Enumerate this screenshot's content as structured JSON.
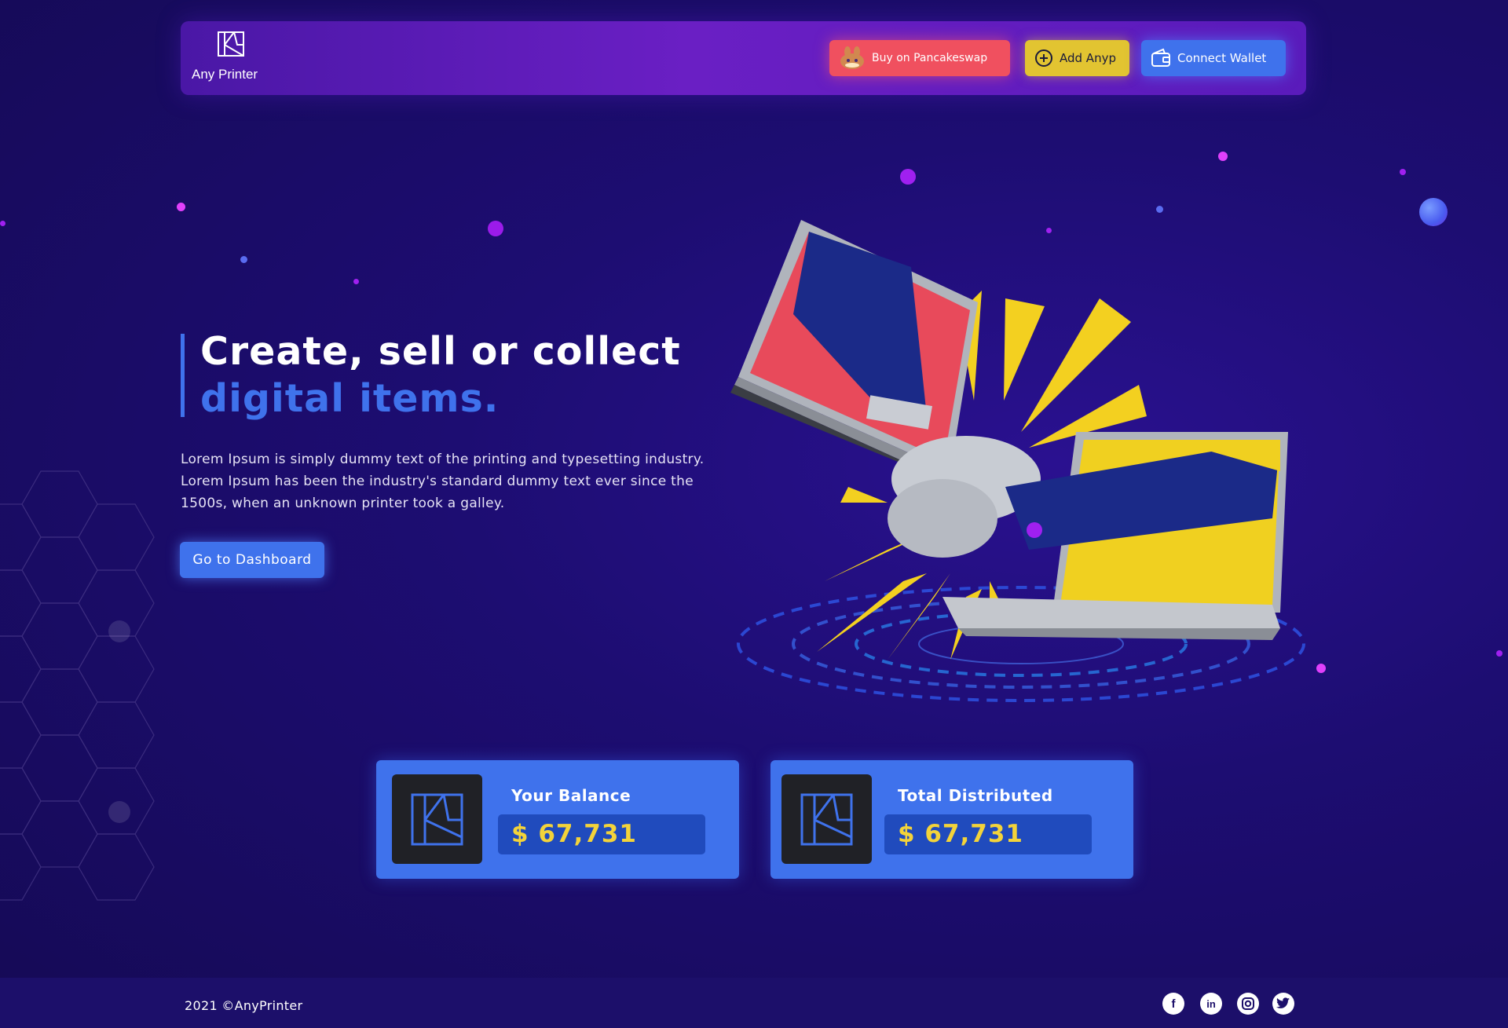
{
  "brand": {
    "name": "Any Printer"
  },
  "header": {
    "buttons": {
      "pancake": "Buy on Pancakeswap",
      "anyp": "Add Anyp",
      "wallet": "Connect Wallet"
    }
  },
  "hero": {
    "title_line1": "Create, sell or collect",
    "title_line2": "digital items.",
    "description": "Lorem Ipsum is simply dummy text of the printing and typesetting industry. Lorem Ipsum has been the industry's standard dummy text ever since the 1500s, when an unknown printer took a galley.",
    "cta": "Go to Dashboard"
  },
  "stats": [
    {
      "label": "Your Balance",
      "value": "$ 67,731"
    },
    {
      "label": "Total Distributed",
      "value": "$ 67,731"
    }
  ],
  "footer": {
    "copyright": "2021 ©AnyPrinter",
    "social": [
      "facebook-icon",
      "linkedin-icon",
      "instagram-icon",
      "twitter-icon"
    ]
  },
  "colors": {
    "accent": "#3f72ec",
    "pancake": "#f0505f",
    "anyp": "#e2c431",
    "value": "#f3d33a",
    "background": "#1d0d72"
  }
}
